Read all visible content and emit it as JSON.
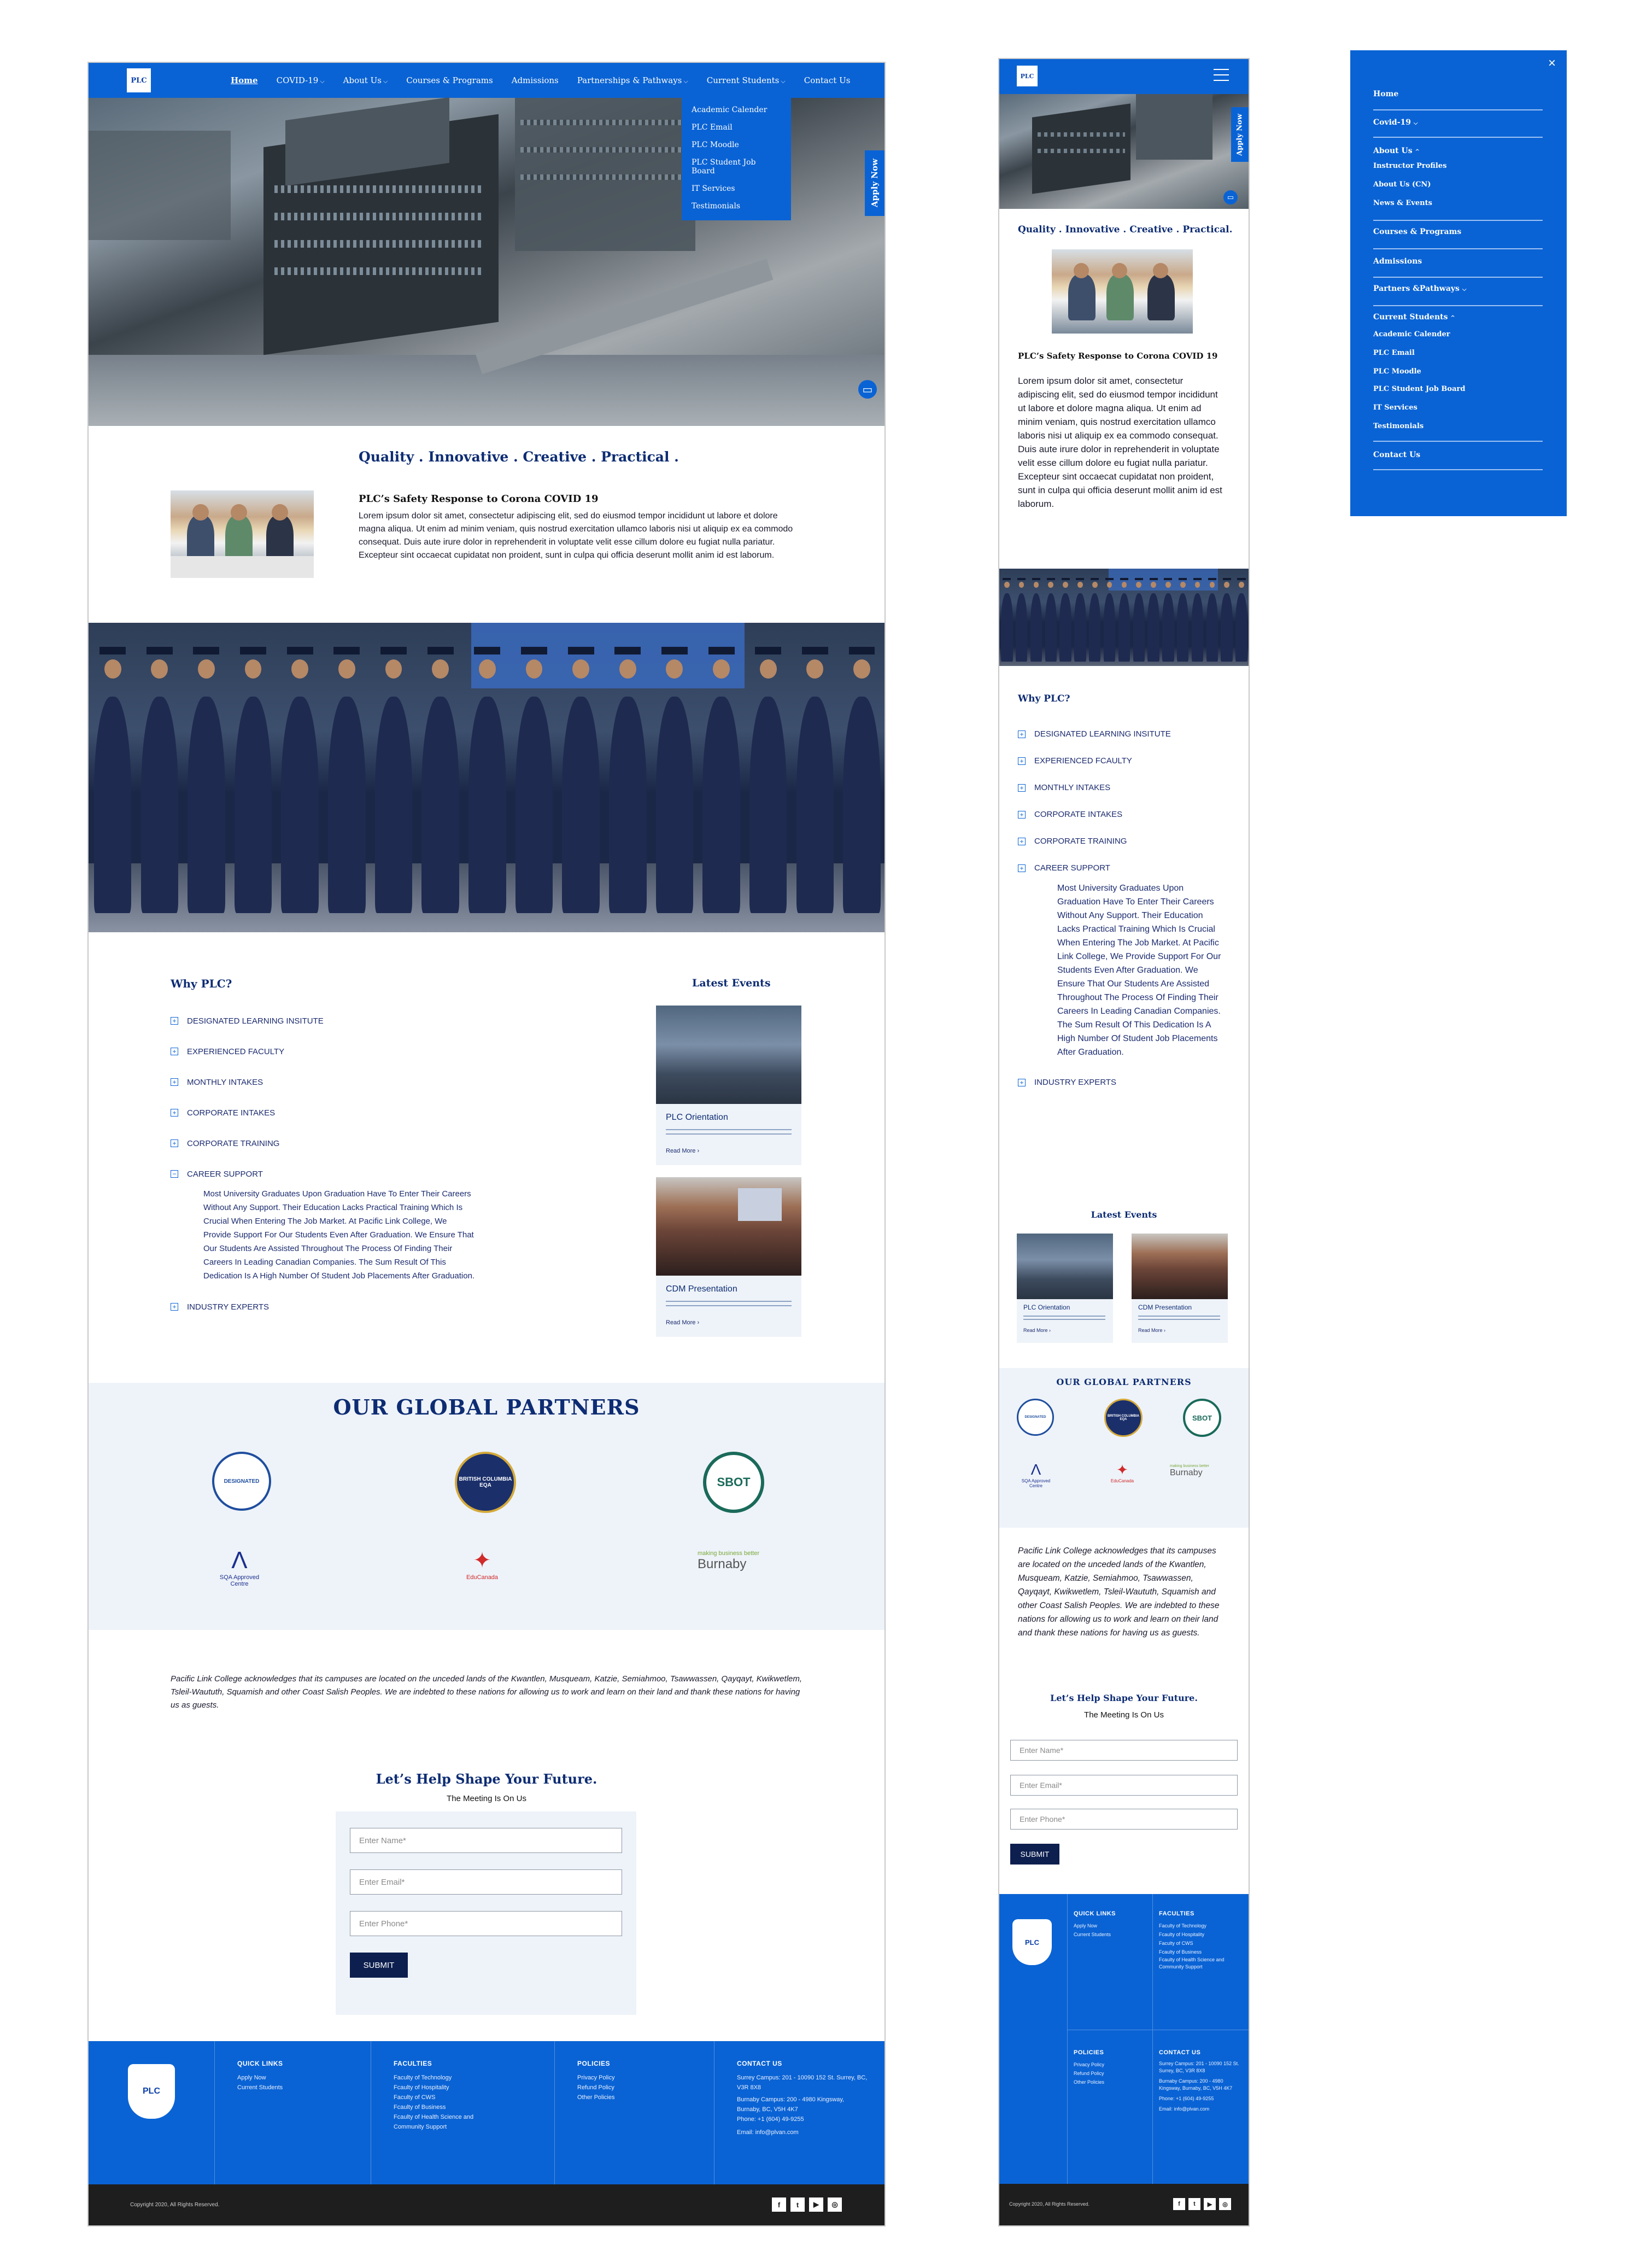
{
  "site": {
    "logo_text": "PLC"
  },
  "nav": {
    "items": [
      {
        "label": "Home"
      },
      {
        "label": "COVID-19"
      },
      {
        "label": "About Us"
      },
      {
        "label": "Courses & Programs"
      },
      {
        "label": "Admissions"
      },
      {
        "label": "Partnerships & Pathways"
      },
      {
        "label": "Current Students"
      },
      {
        "label": "Contact Us"
      }
    ],
    "dropdown": [
      "Academic Calender",
      "PLC Email",
      "PLC Moodle",
      "PLC Student Job Board",
      "IT Services",
      "Testimonials"
    ]
  },
  "apply_tab": "Apply Now",
  "intro": {
    "tagline": "Quality . Innovative . Creative . Practical .",
    "mobile_tagline": "Quality . Innovative . Creative . Practical.",
    "heading": "PLC’s Safety Response to Corona COVID 19",
    "body": "Lorem ipsum dolor sit amet, consectetur adipiscing elit, sed do eiusmod tempor incididunt ut labore et dolore magna aliqua. Ut enim ad minim veniam, quis nostrud exercitation ullamco laboris nisi ut aliquip ex ea commodo consequat. Duis aute irure dolor in reprehenderit in voluptate velit esse cillum dolore eu fugiat nulla pariatur. Excepteur sint occaecat cupidatat non proident, sunt in culpa qui officia deserunt mollit anim id est laborum.",
    "mobile_body": "Lorem ipsum dolor sit amet, consectetur adipiscing elit, sed do eiusmod tempor incididunt ut labore et dolore magna aliqua. Ut enim ad minim veniam, quis nostrud exercitation ullamco laboris nisi ut aliquip ex ea commodo consequat. Duis aute irure dolor in reprehenderit in voluptate velit esse cillum dolore eu fugiat nulla pariatur. Excepteur sint occaecat cupidatat non proident, sunt in culpa qui officia deserunt mollit anim id est laborum."
  },
  "why": {
    "title": "Why PLC?",
    "items": [
      "DESIGNATED LEARNING INSITUTE",
      "EXPERIENCED FACULTY",
      "MONTHLY INTAKES",
      "CORPORATE INTAKES",
      "CORPORATE TRAINING",
      "CAREER SUPPORT"
    ],
    "mobile_items": [
      "DESIGNATED LEARNING INSITUTE",
      "EXPERIENCED FCAULTY",
      "MONTHLY INTAKES",
      "CORPORATE INTAKES",
      "CORPORATE TRAINING",
      "CAREER SUPPORT"
    ],
    "expanded_text": "Most University Graduates Upon Graduation Have To Enter Their Careers Without Any Support. Their Education Lacks Practical Training Which Is Crucial When Entering The Job Market. At Pacific Link College, We Provide Support For Our Students Even After Graduation. We Ensure That Our Students Are Assisted Throughout The Process Of Finding Their Careers In Leading Canadian Companies. The Sum Result Of This Dedication Is A High Number Of Student Job Placements After Graduation.",
    "last_item": "INDUSTRY EXPERTS"
  },
  "events": {
    "title": "Latest Events",
    "items": [
      {
        "title": "PLC Orientation",
        "link": "Read More"
      },
      {
        "title": "CDM Presentation",
        "link": "Read More"
      }
    ]
  },
  "partners": {
    "title": "OUR GLOBAL PARTNERS",
    "logos": [
      {
        "name": "designated-learning-institution",
        "text": "DESIGNATED"
      },
      {
        "name": "british-columbia-eqa",
        "text": "BRITISH COLUMBIA EQA"
      },
      {
        "name": "sbot",
        "text": "SBOT"
      },
      {
        "name": "sqa-approved",
        "text": "SQA Approved Centre"
      },
      {
        "name": "educanada",
        "text": "EduCanada"
      },
      {
        "name": "burnaby",
        "text": "Burnaby",
        "tag": "making business better"
      }
    ]
  },
  "acknowledgement": "Pacific Link College acknowledges that its campuses are located on the unceded lands of the Kwantlen, Musqueam, Katzie, Semiahmoo, Tsawwassen, Qayqayt, Kwikwetlem, Tsleil-Waututh, Squamish and other Coast Salish Peoples. We are indebted to these nations for allowing us to work and learn on their land and thank these nations for having us as guests.",
  "contact_form": {
    "title": "Let’s Help Shape Your Future.",
    "subtitle": "The Meeting Is On Us",
    "name_placeholder": "Enter Name*",
    "email_placeholder": "Enter Email*",
    "phone_placeholder": "Enter Phone*",
    "submit": "SUBMIT"
  },
  "footer": {
    "quick_links": {
      "title": "QUICK LINKS",
      "items": [
        "Apply Now",
        "Current Students"
      ]
    },
    "faculties": {
      "title": "FACULTIES",
      "items": [
        "Faculty of Technology",
        "Fcaulty of Hospitality",
        "Faculty of CWS",
        "Fcaulty of Business",
        "Fcaulty of Health Science and Community Support"
      ]
    },
    "policies": {
      "title": "POLICIES",
      "items": [
        "Privacy Policy",
        "Refund Policy",
        "Other Policies"
      ]
    },
    "contact": {
      "title": "CONTACT US",
      "surrey": "Surrey Campus: 201 - 10090 152 St. Surrey, BC, V3R 8X8",
      "burnaby": "Burnaby Campus: 200 - 4980 Kingsway, Burnaby, BC, V5H 4K7",
      "phone": "Phone: +1 (604) 49-9255",
      "email": "Email: info@plvan.com"
    },
    "copyright": "Copyright 2020, All Rights Reserved.",
    "social": [
      "f",
      "t",
      "▶",
      "◎"
    ]
  },
  "mobile_menu": {
    "close": "×",
    "items": [
      "Home",
      "Covid-19",
      "About Us",
      "Instructor Profiles",
      "About Us (CN)",
      "News & Events",
      "Courses & Programs",
      "Admissions",
      "Partners &Pathways",
      "Current Students",
      "Academic Calender",
      "PLC Email",
      "PLC Moodle",
      "PLC Student Job Board",
      "IT Services",
      "Testimonials",
      "Contact Us"
    ]
  },
  "colors": {
    "brand_blue": "#0a63d4",
    "navy": "#0d2c73",
    "light_panel": "#eef3f9",
    "dark_bar": "#1e1e1e"
  }
}
